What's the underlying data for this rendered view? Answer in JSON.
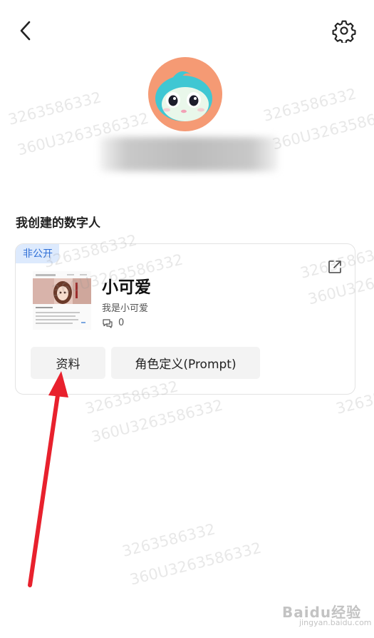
{
  "header": {
    "back_icon": "chevron-left-icon",
    "settings_icon": "gear-icon"
  },
  "profile": {
    "avatar_icon": "cartoon-mascot-avatar",
    "avatar_bg": "#f59a74"
  },
  "section": {
    "title": "我创建的数字人"
  },
  "bot_card": {
    "badge": "非公开",
    "name": "小可爱",
    "description": "我是小可爱",
    "chat_count": "0",
    "share_icon": "share-external-icon",
    "chat_icon": "chat-bubbles-icon",
    "buttons": {
      "info": "资料",
      "prompt": "角色定义(Prompt)"
    }
  },
  "annotation": {
    "arrow_color": "#e8212d"
  },
  "watermarks": [
    "360U3263586332",
    "3263586332"
  ],
  "baidu": {
    "logo": "Baidu经验",
    "url": "jingyan.baidu.com"
  }
}
